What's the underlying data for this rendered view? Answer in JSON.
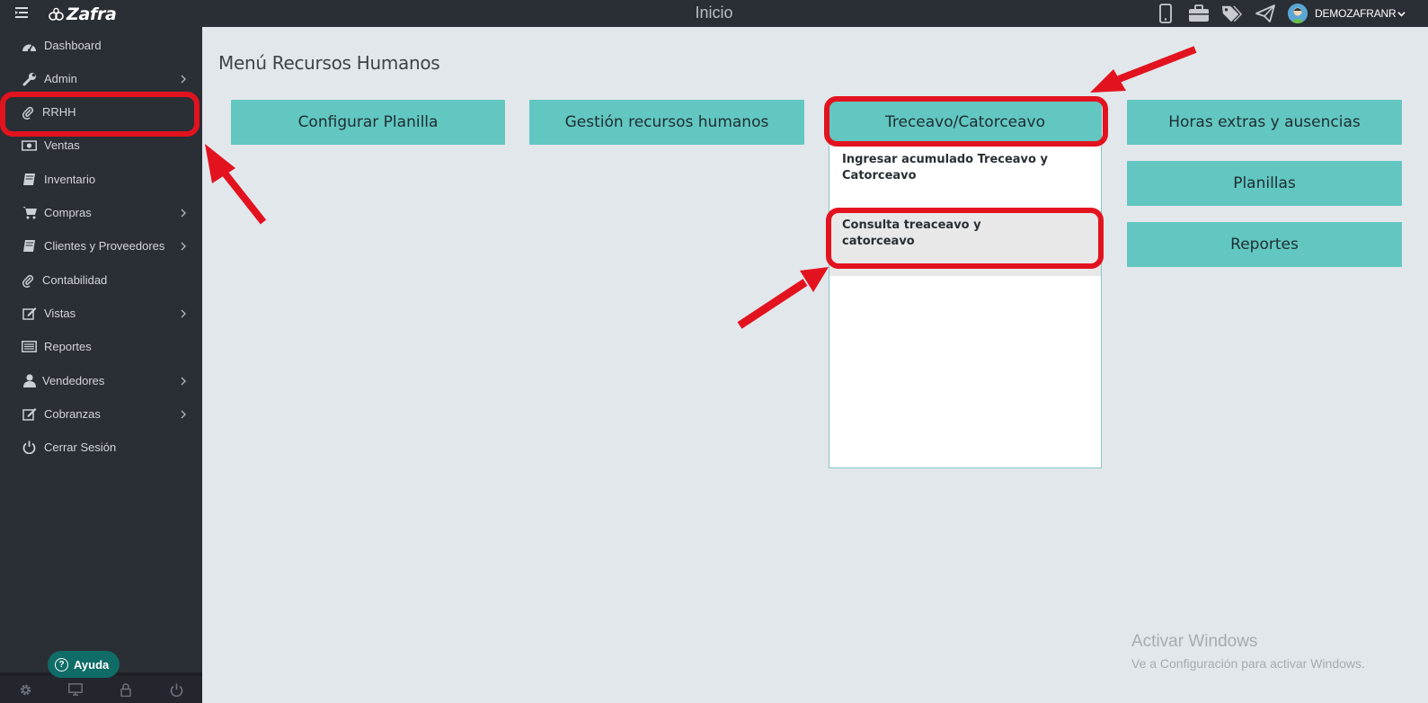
{
  "topbar": {
    "brand": "Zafra",
    "heading": "Inicio",
    "icons": [
      "mobile-icon",
      "briefcase-icon",
      "tags-icon",
      "paper-plane-icon"
    ],
    "user_name": "DEMOZAFRANR"
  },
  "sidebar": {
    "items": [
      {
        "label": "Dashboard",
        "icon": "dashboard-icon",
        "has_submenu": false
      },
      {
        "label": "Admin",
        "icon": "wrench-icon",
        "has_submenu": true
      },
      {
        "label": "RRHH",
        "icon": "paperclip-icon",
        "has_submenu": false
      },
      {
        "label": "Ventas",
        "icon": "money-icon",
        "has_submenu": false
      },
      {
        "label": "Inventario",
        "icon": "book-icon",
        "has_submenu": false
      },
      {
        "label": "Compras",
        "icon": "cart-icon",
        "has_submenu": true
      },
      {
        "label": "Clientes y Proveedores",
        "icon": "book-icon",
        "has_submenu": true
      },
      {
        "label": "Contabilidad",
        "icon": "paperclip-icon",
        "has_submenu": false
      },
      {
        "label": "Vistas",
        "icon": "edit-icon",
        "has_submenu": true
      },
      {
        "label": "Reportes",
        "icon": "list-icon",
        "has_submenu": false
      },
      {
        "label": "Vendedores",
        "icon": "user-icon",
        "has_submenu": true
      },
      {
        "label": "Cobranzas",
        "icon": "edit-icon",
        "has_submenu": true
      },
      {
        "label": "Cerrar Sesión",
        "icon": "power-icon",
        "has_submenu": false
      }
    ],
    "help_label": "Ayuda",
    "footer_icons": [
      "gear-icon",
      "monitor-icon",
      "lock-icon",
      "power-icon"
    ]
  },
  "main": {
    "title": "Menú Recursos Humanos",
    "buttons": {
      "configurar": "Configurar Planilla",
      "gestion": "Gestión recursos humanos",
      "treceavo": "Treceavo/Catorceavo",
      "horas": "Horas extras y ausencias",
      "planillas": "Planillas",
      "reportes": "Reportes"
    },
    "dropdown": {
      "item1_line1": "Ingresar acumulado Treceavo y",
      "item1_line2": "Catorceavo",
      "item2_line1": "Consulta treaceavo y",
      "item2_line2": "catorceavo"
    }
  },
  "watermark": {
    "title": "Activar Windows",
    "subtitle": "Ve a Configuración para activar Windows."
  },
  "colors": {
    "sidebar_bg": "#2a2e35",
    "button_teal": "#62c6c1",
    "annotation_red": "#e2131f"
  }
}
